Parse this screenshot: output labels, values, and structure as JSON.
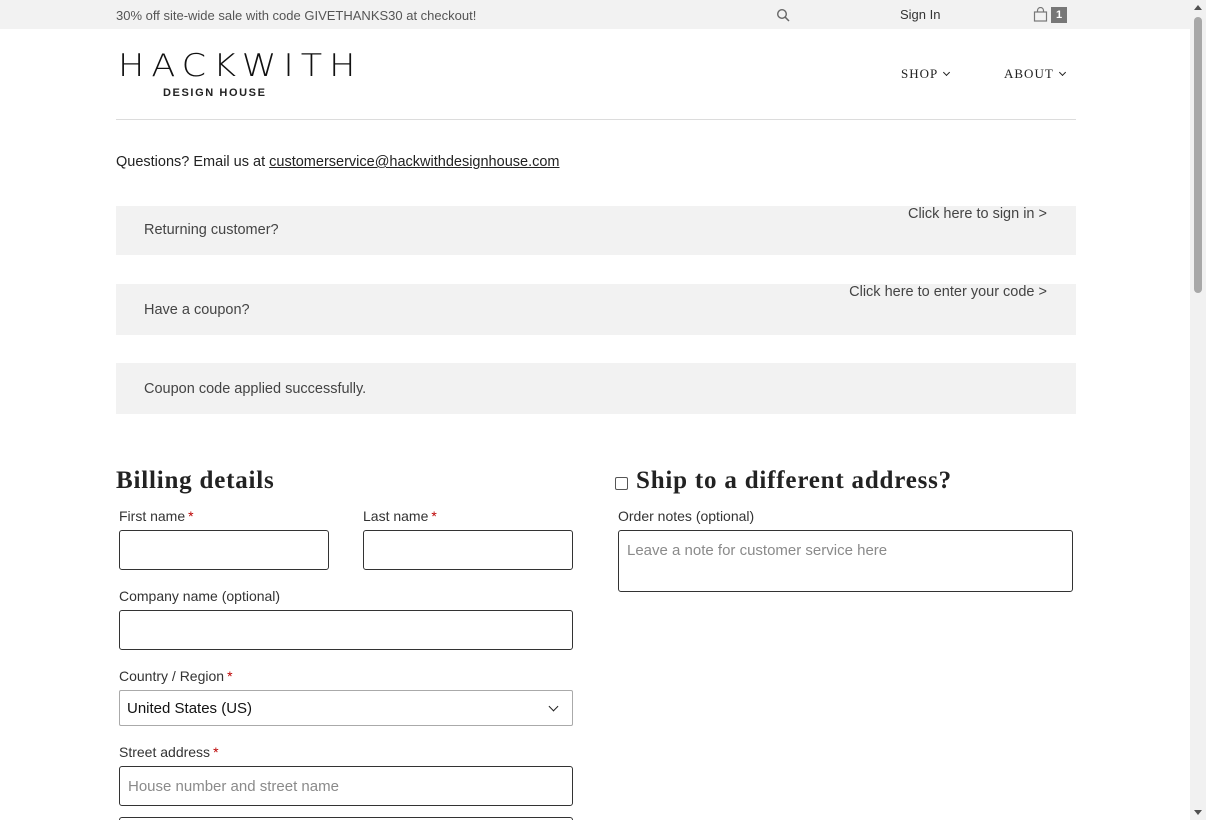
{
  "topbar": {
    "promo": "30% off site-wide sale with code GIVETHANKS30 at checkout!",
    "sign_in": "Sign In",
    "cart_count": "1"
  },
  "logo": {
    "main": "HACKWITH",
    "sub": "DESIGN HOUSE"
  },
  "nav": {
    "shop": "SHOP",
    "about": "ABOUT"
  },
  "questions": {
    "text": "Questions? Email us at ",
    "email": "customerservice@hackwithdesignhouse.com"
  },
  "notices": {
    "returning": {
      "text": "Returning customer?",
      "link": "Click here to sign in >"
    },
    "coupon": {
      "text": "Have a coupon?",
      "link": "Click here to enter your code >"
    },
    "applied": "Coupon code applied successfully."
  },
  "billing": {
    "heading": "Billing details",
    "first_name_label": "First name",
    "last_name_label": "Last name",
    "company_label": "Company name (optional)",
    "country_label": "Country / Region",
    "country_value": "United States (US)",
    "street_label": "Street address",
    "street_placeholder": "House number and street name",
    "required_mark": "*"
  },
  "shipping": {
    "heading": "Ship to a different address?",
    "order_notes_label": "Order notes (optional)",
    "order_notes_placeholder": "Leave a note for customer service here"
  }
}
